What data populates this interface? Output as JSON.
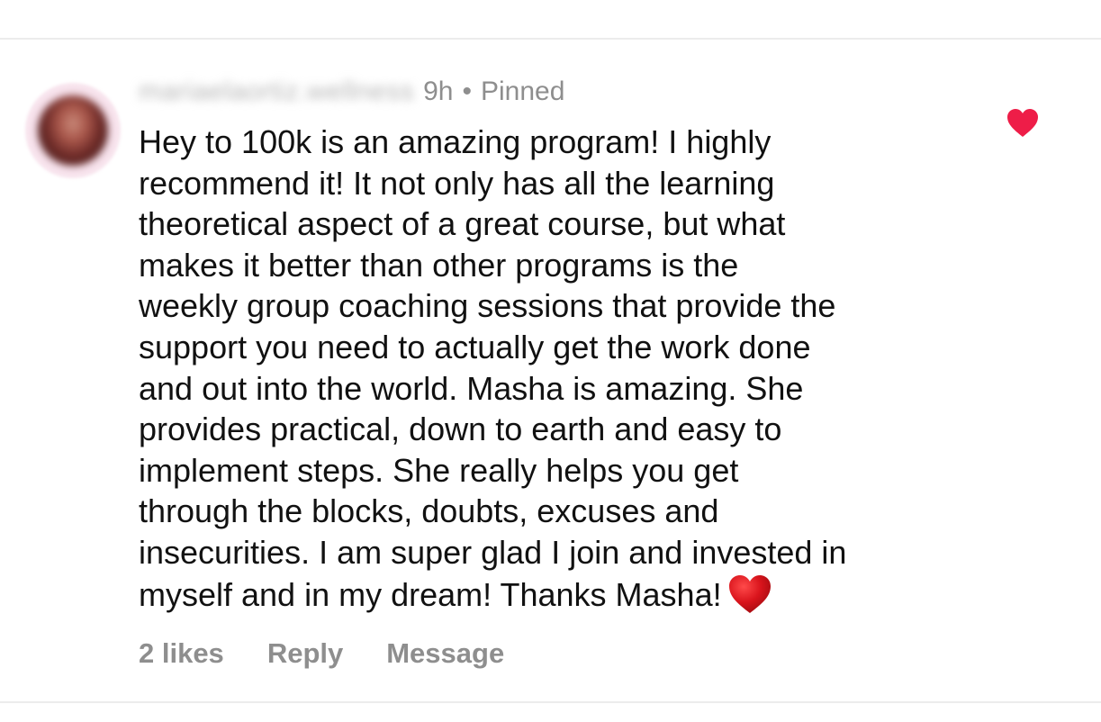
{
  "comment": {
    "username": "mariaelaortiz.wellness",
    "time": "9h",
    "separator": "•",
    "pinned_label": "Pinned",
    "liked_icon": "heart-filled-icon",
    "like_color": "#ee1d48",
    "lines": [
      "Hey to 100k is an amazing program! I highly",
      "recommend it! It not only has all the learning",
      "theoretical aspect of a great course, but what",
      "makes it better than other programs is the",
      "weekly group coaching sessions that provide the",
      "support you need to actually get the work done",
      "and out into the world. Masha is amazing. She",
      "provides practical, down to earth and easy to",
      "implement steps. She really helps you get",
      "through the blocks, doubts, excuses and",
      "insecurities. I am super glad I join and invested in",
      "myself and in my dream! Thanks Masha!"
    ],
    "trailing_emoji": "red-heart-emoji"
  },
  "actions": {
    "likes": "2 likes",
    "reply": "Reply",
    "message": "Message"
  }
}
